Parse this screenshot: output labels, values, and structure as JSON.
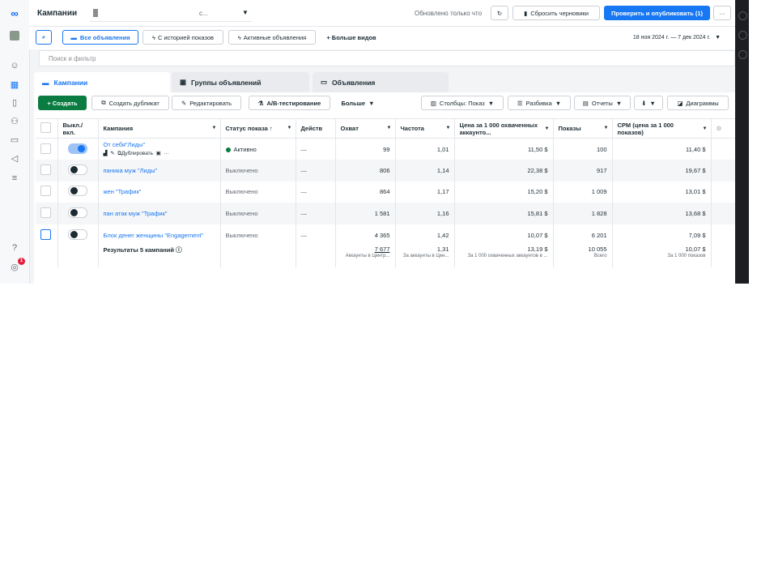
{
  "header": {
    "title": "Кампании",
    "account_suffix": "с...",
    "updated": "Обновлено только что",
    "discard_drafts": "Сбросить черновики",
    "review_publish": "Проверить и опубликовать (1)",
    "more": "···"
  },
  "views": {
    "all_ads": "Все объявления",
    "with_history": "С историей показов",
    "active_ads": "Активные объявления",
    "more_views": "+ Больше видов",
    "date_range": "18 ноя 2024 г. — 7 дек 2024 г."
  },
  "search": {
    "placeholder": "Поиск и фильтр"
  },
  "tabs": [
    {
      "label": "Кампании"
    },
    {
      "label": "Группы объявлений"
    },
    {
      "label": "Объявления"
    }
  ],
  "toolbar": {
    "create": "+ Создать",
    "duplicate": "Создать дубликат",
    "edit": "Редактировать",
    "ab_test": "A/B-тестирование",
    "more": "Больше",
    "columns": "Столбцы: Показ",
    "breakdown": "Разбивка",
    "reports": "Отчеты",
    "export": "⬇",
    "charts": "Диаграммы"
  },
  "table": {
    "headers": {
      "toggle": "Выкл./ вкл.",
      "campaign": "Кампания",
      "status": "Статус показа ↑",
      "actions": "Действ",
      "reach": "Охват",
      "frequency": "Частота",
      "cost_per_1000_reached": "Цена за 1 000 охваченных аккаунто...",
      "impressions": "Показы",
      "cpm": "CPM (цена за 1 000 показов)"
    },
    "row_actions": {
      "duplicate": "Дублировать",
      "more": "···"
    },
    "rows": [
      {
        "name": "От себя\"Лиды\"",
        "status": "Активно",
        "actions": "—",
        "reach": "99",
        "frequency": "1,01",
        "cost": "11,50 $",
        "impressions": "100",
        "cpm": "11,40 $",
        "on": true
      },
      {
        "name": "паника муж \"Лиды\"",
        "status": "Выключено",
        "actions": "—",
        "reach": "806",
        "frequency": "1,14",
        "cost": "22,38 $",
        "impressions": "917",
        "cpm": "19,67 $",
        "on": false
      },
      {
        "name": "жен \"Трафик\"",
        "status": "Выключено",
        "actions": "—",
        "reach": "864",
        "frequency": "1,17",
        "cost": "15,20 $",
        "impressions": "1 009",
        "cpm": "13,01 $",
        "on": false
      },
      {
        "name": "пан атак муж \"Трафик\"",
        "status": "Выключено",
        "actions": "—",
        "reach": "1 581",
        "frequency": "1,16",
        "cost": "15,81 $",
        "impressions": "1 828",
        "cpm": "13,68 $",
        "on": false
      },
      {
        "name": "Блок денег женщины \"Engagement\"",
        "status": "Выключено",
        "actions": "—",
        "reach": "4 365",
        "frequency": "1,42",
        "cost": "10,07 $",
        "impressions": "6 201",
        "cpm": "7,09 $",
        "on": false
      }
    ],
    "summary": {
      "label": "Результаты 5 кампаний",
      "reach": "7 677",
      "reach_sub": "Аккаунты в Центр...",
      "frequency": "1,31",
      "frequency_sub": "За аккаунты в Цен...",
      "cost": "13,19 $",
      "cost_sub": "За 1 000 охваченных аккаунтов в ...",
      "impressions": "10 055",
      "impressions_sub": "Всего",
      "cpm": "10,07 $",
      "cpm_sub": "За 1 000 показов"
    }
  },
  "nav_badge": "1",
  "colors": {
    "accent": "#1877f2",
    "create": "#0a7c42",
    "active_status": "#0a7c42"
  }
}
